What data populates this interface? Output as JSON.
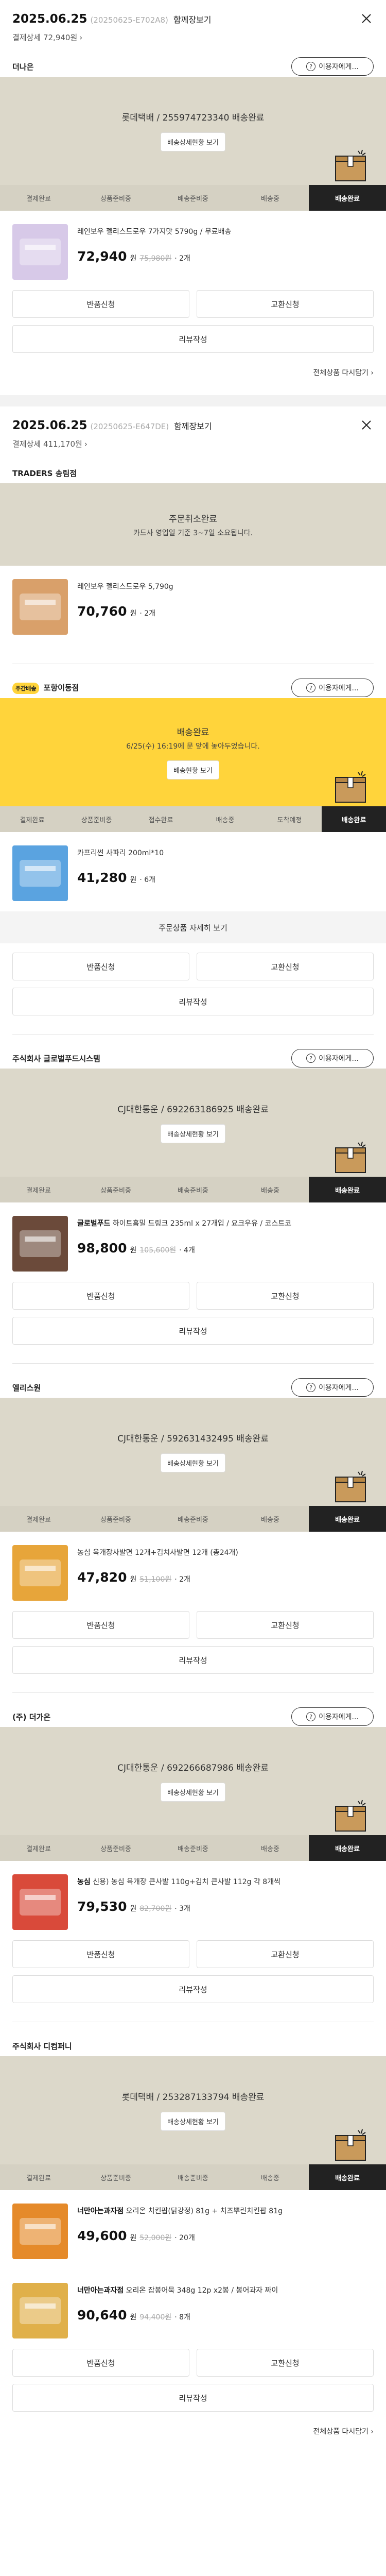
{
  "orders": [
    {
      "date": "2025.06.25",
      "order_no": "(20250625-E702A8)",
      "group_label": "함께장보기",
      "payment": "결제상세 72,940원",
      "sellers": [
        {
          "name": "더나은",
          "help": "이용자에게...",
          "banner": {
            "title": "롯데택배 / 255974723340 배송완료",
            "sub": "",
            "button": "배송상세현황 보기"
          },
          "steps": [
            "결제완료",
            "상품준비중",
            "배송준비중",
            "배송중",
            "배송완료"
          ],
          "products": [
            {
              "name": "레인보우 젤리스드로우 7가지맛 5790g / 무료배송",
              "brand": "",
              "price": "72,940",
              "won": "원",
              "old": "75,980원",
              "qty": "· 2개",
              "color": "#d7c9e8"
            }
          ],
          "buttons": [
            "반품신청",
            "교환신청",
            "리뷰작성"
          ]
        }
      ],
      "reorder": "전체상품 다시담기"
    },
    {
      "date": "2025.06.25",
      "order_no": "(20250625-E647DE)",
      "group_label": "함께장보기",
      "payment": "결제상세 411,170원",
      "sellers": [
        {
          "name": "TRADERS 송림점",
          "help": "",
          "banner": {
            "title": "주문취소완료",
            "sub": "카드사 영업일 기준 3~7일 소요됩니다.",
            "button": ""
          },
          "steps": [],
          "products": [
            {
              "name": "레인보우 젤리스드로우 5,790g",
              "brand": "",
              "price": "70,760",
              "won": "원",
              "old": "",
              "qty": "· 2개",
              "color": "#d9a06a"
            }
          ],
          "buttons": []
        },
        {
          "name": "포항이동점",
          "badge": "주간배송",
          "help": "이용자에게...",
          "banner": {
            "title": "배송완료",
            "sub": "6/25(수) 16:19에 문 앞에 놓아두었습니다.",
            "button": "배송현황 보기"
          },
          "steps": [
            "결제완료",
            "상품준비중",
            "접수완료",
            "배송중",
            "도착예정",
            "배송완료"
          ],
          "products": [
            {
              "name": "카프리썬 사파리 200ml*10",
              "brand": "",
              "price": "41,280",
              "won": "원",
              "old": "",
              "qty": "· 6개",
              "color": "#5aa3e0"
            }
          ],
          "detail_link": "주문상품 자세히 보기",
          "buttons": [
            "반품신청",
            "교환신청",
            "리뷰작성"
          ]
        },
        {
          "name": "주식회사 글로벌푸드시스템",
          "help": "이용자에게...",
          "banner": {
            "title": "CJ대한통운 / 692263186925 배송완료",
            "sub": "",
            "button": "배송상세현황 보기"
          },
          "steps": [
            "결제완료",
            "상품준비중",
            "배송준비중",
            "배송중",
            "배송완료"
          ],
          "products": [
            {
              "name": "하이트홈밀 드링크 235ml x 27개입 / 요크우유 / 코스트코",
              "brand": "글로벌푸드",
              "price": "98,800",
              "won": "원",
              "old": "105,600원",
              "qty": "· 4개",
              "color": "#6b4a3a"
            }
          ],
          "buttons": [
            "반품신청",
            "교환신청",
            "리뷰작성"
          ]
        },
        {
          "name": "엘리스원",
          "help": "이용자에게...",
          "banner": {
            "title": "CJ대한통운 / 592631432495 배송완료",
            "sub": "",
            "button": "배송상세현황 보기"
          },
          "steps": [
            "결제완료",
            "상품준비중",
            "배송준비중",
            "배송중",
            "배송완료"
          ],
          "products": [
            {
              "name": "농심 육개장사발면 12개+김치사발면 12개 (총24개)",
              "brand": "",
              "price": "47,820",
              "won": "원",
              "old": "51,100원",
              "qty": "· 2개",
              "color": "#e7a53a"
            }
          ],
          "buttons": [
            "반품신청",
            "교환신청",
            "리뷰작성"
          ]
        },
        {
          "name": "(주) 더가온",
          "help": "이용자에게...",
          "banner": {
            "title": "CJ대한통운 / 692266687986 배송완료",
            "sub": "",
            "button": "배송상세현황 보기"
          },
          "steps": [
            "결제완료",
            "상품준비중",
            "배송준비중",
            "배송중",
            "배송완료"
          ],
          "products": [
            {
              "name": "신용) 농심 육개장 큰사발 110g+김치 큰사발 112g 각 8개씩",
              "brand": "농심",
              "price": "79,530",
              "won": "원",
              "old": "82,700원",
              "qty": "· 3개",
              "color": "#d94a3a"
            }
          ],
          "buttons": [
            "반품신청",
            "교환신청",
            "리뷰작성"
          ]
        },
        {
          "name": "주식회사 디컴퍼니",
          "help": "",
          "banner": {
            "title": "롯데택배 / 253287133794 배송완료",
            "sub": "",
            "button": "배송상세현황 보기"
          },
          "steps": [
            "결제완료",
            "상품준비중",
            "배송준비중",
            "배송중",
            "배송완료"
          ],
          "products": [
            {
              "name": "오리온 치킨팝(닭강정) 81g + 치즈뿌린치킨팝 81g",
              "brand": "너만아는과자점",
              "price": "49,600",
              "won": "원",
              "old": "52,000원",
              "qty": "· 20개",
              "color": "#e58a2a"
            },
            {
              "name": "오리온 잡봉어묵 348g 12p x2봉 / 봉어과자 짜이",
              "brand": "너만아는과자점",
              "price": "90,640",
              "won": "원",
              "old": "94,400원",
              "qty": "· 8개",
              "color": "#e0b04a"
            }
          ],
          "buttons": [
            "반품신청",
            "교환신청",
            "리뷰작성"
          ]
        }
      ],
      "reorder": "전체상품 다시담기"
    }
  ],
  "icons": {
    "close": "close-icon",
    "chevron": "chevron-right-icon",
    "help": "help-icon",
    "box": "box-icon"
  },
  "colors": {
    "banner": "#dcd8ca",
    "banner_yellow": "#ffd43b",
    "active_step": "#222222"
  }
}
